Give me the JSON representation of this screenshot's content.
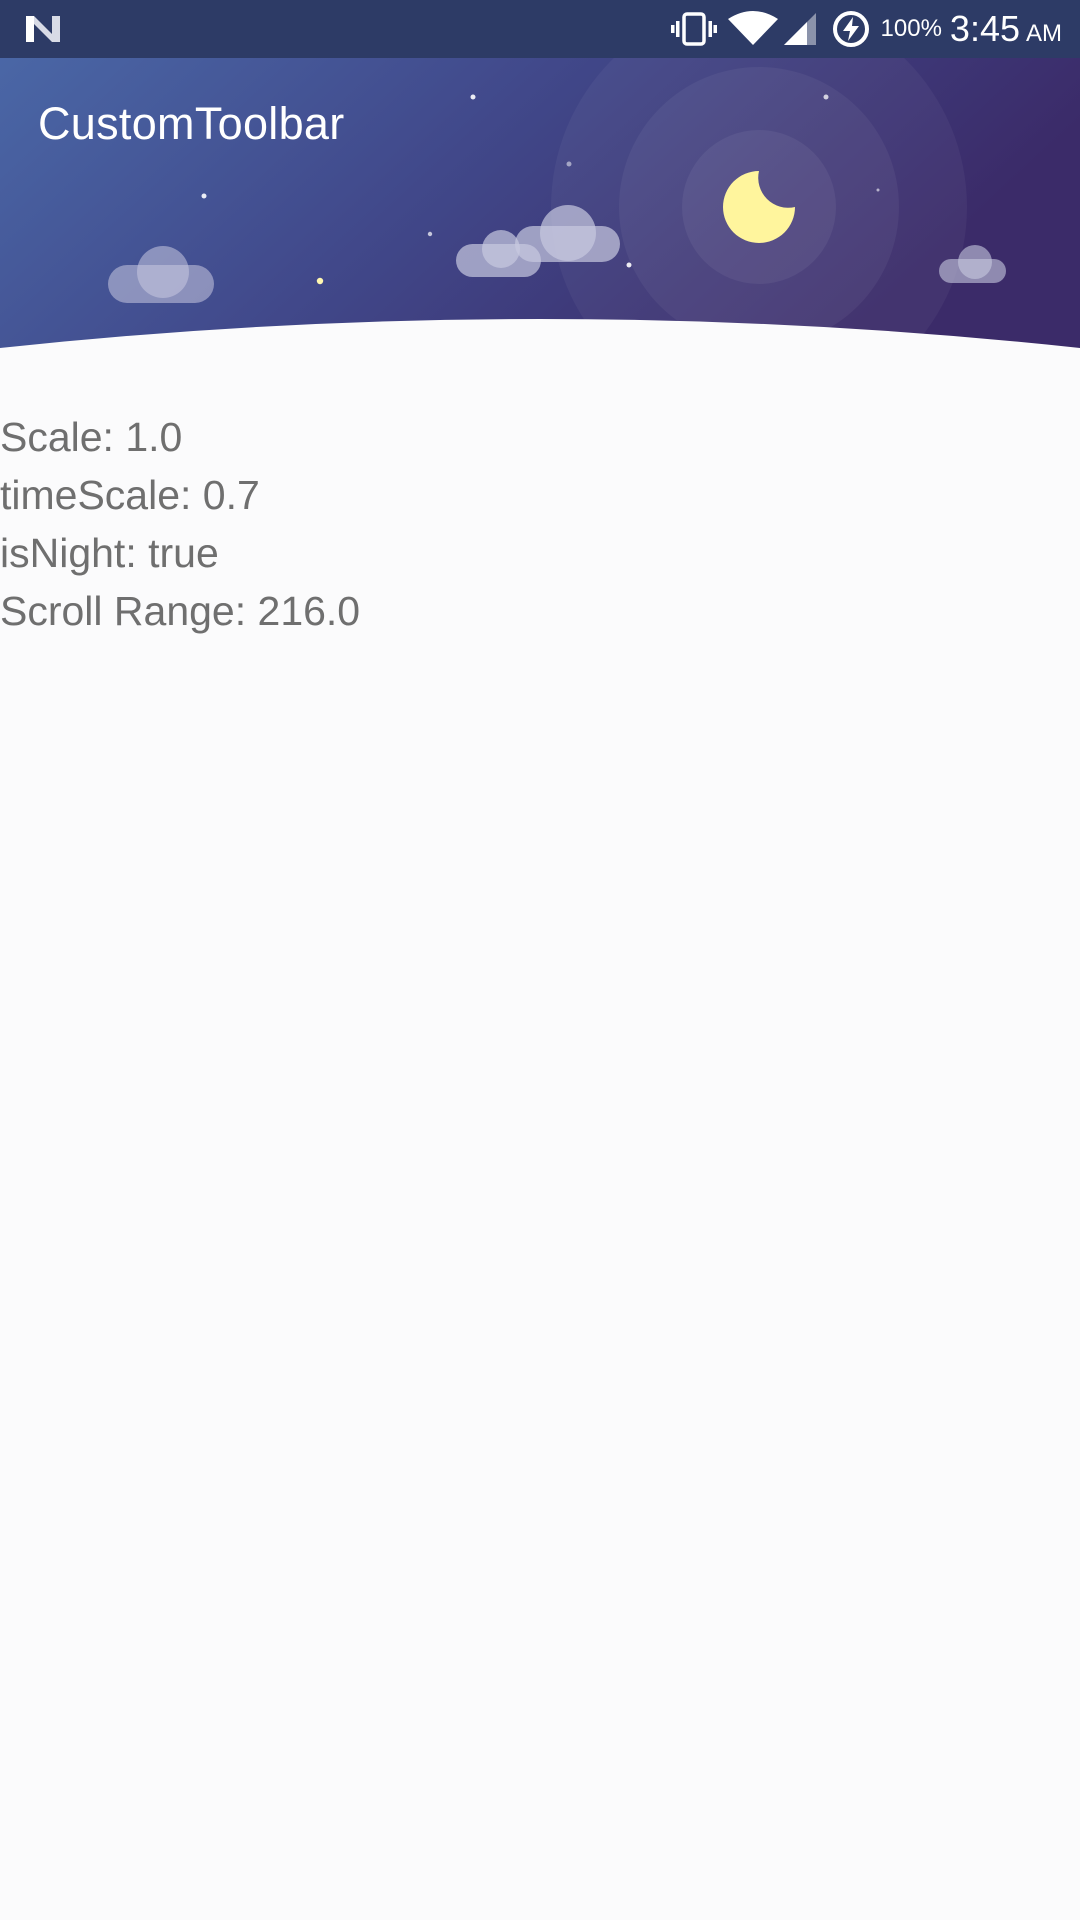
{
  "status_bar": {
    "left_icon": "n-logo-icon",
    "icons": [
      "vibrate-icon",
      "wifi-icon",
      "signal-icon",
      "battery-charging-icon"
    ],
    "battery": "100%",
    "time": "3:45",
    "ampm": "AM"
  },
  "toolbar": {
    "title": "CustomToolbar",
    "scene": "night",
    "colors": {
      "gradient_start": "#4a6aa8",
      "gradient_end": "#3a2b6a",
      "moon": "#fff59d",
      "cloud": "#c8c9e0"
    }
  },
  "info": {
    "scale": "Scale: 1.0",
    "time_scale": "timeScale: 0.7",
    "is_night": "isNight: true",
    "scroll_range": "Scroll Range: 216.0"
  }
}
